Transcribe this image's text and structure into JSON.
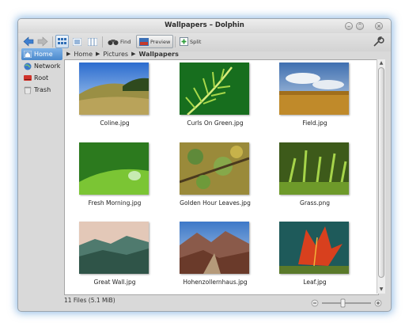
{
  "window": {
    "title": "Wallpapers – Dolphin"
  },
  "toolbar": {
    "find_label": "Find",
    "preview_label": "Preview",
    "split_label": "Split"
  },
  "sidebar": {
    "items": [
      {
        "label": "Home",
        "icon": "home-icon",
        "selected": true
      },
      {
        "label": "Network",
        "icon": "network-icon",
        "selected": false
      },
      {
        "label": "Root",
        "icon": "drive-icon",
        "selected": false
      },
      {
        "label": "Trash",
        "icon": "trash-icon",
        "selected": false
      }
    ]
  },
  "breadcrumb": {
    "items": [
      "Home",
      "Pictures",
      "Wallpapers"
    ]
  },
  "files": [
    {
      "name": "Coline.jpg"
    },
    {
      "name": "Curls On Green.jpg"
    },
    {
      "name": "Field.jpg"
    },
    {
      "name": "Fresh Morning.jpg"
    },
    {
      "name": "Golden Hour Leaves.jpg"
    },
    {
      "name": "Grass.png"
    },
    {
      "name": "Great Wall.jpg"
    },
    {
      "name": "Hohenzollernhaus.jpg"
    },
    {
      "name": "Leaf.jpg"
    }
  ],
  "status": {
    "text": "11 Files (5.1 MiB)"
  },
  "colors": {
    "selection": "#4a88cc",
    "window_glow": "#468cd2",
    "background": "#d9d9d9"
  }
}
